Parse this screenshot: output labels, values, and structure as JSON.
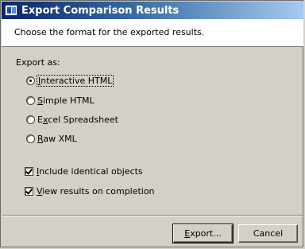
{
  "window": {
    "title": "Export Comparison Results",
    "description": "Choose the format for the exported results."
  },
  "export_as": {
    "label": "Export as:",
    "options": [
      {
        "mnemonic": "I",
        "rest": "nteractive HTML",
        "selected": true
      },
      {
        "mnemonic": "S",
        "rest": "imple HTML",
        "selected": false
      },
      {
        "pre": "E",
        "mnemonic": "x",
        "rest": "cel Spreadsheet",
        "selected": false
      },
      {
        "mnemonic": "R",
        "rest": "aw XML",
        "selected": false
      }
    ]
  },
  "checkboxes": [
    {
      "pre": "",
      "mnemonic": "I",
      "rest": "nclude identical objects",
      "checked": true
    },
    {
      "pre": "",
      "mnemonic": "V",
      "rest": "iew results on completion",
      "checked": true
    }
  ],
  "buttons": {
    "export": {
      "mnemonic": "E",
      "rest": "xport..."
    },
    "cancel": {
      "label": "Cancel"
    }
  },
  "colors": {
    "titlebar_start": "#0a246a",
    "titlebar_end": "#a6caf0",
    "face": "#d4d0c8"
  }
}
